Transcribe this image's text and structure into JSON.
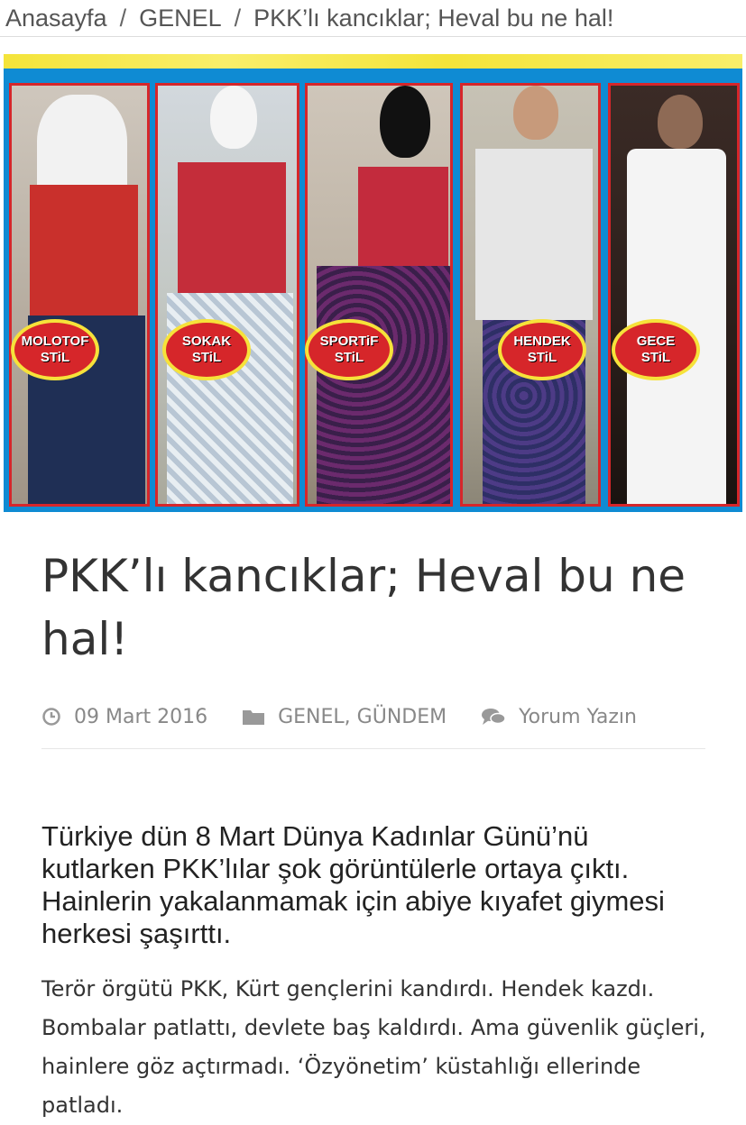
{
  "breadcrumb": {
    "items": [
      "Anasayfa",
      "GENEL",
      "PKK’lı kancıklar; Heval bu ne hal!"
    ],
    "separator": "/"
  },
  "hero": {
    "badges": [
      {
        "line1": "MOLOTOF",
        "line2": "STiL"
      },
      {
        "line1": "SOKAK",
        "line2": "STiL"
      },
      {
        "line1": "SPORTiF",
        "line2": "STiL"
      },
      {
        "line1": "HENDEK",
        "line2": "STiL"
      },
      {
        "line1": "GECE",
        "line2": "STiL"
      }
    ],
    "colors": {
      "background": "#0f8bd3",
      "frame": "#d6262a",
      "badge_ring": "#f6e23a"
    }
  },
  "article": {
    "title": "PKK’lı kancıklar; Heval bu ne hal!",
    "date": "09 Mart 2016",
    "categories": [
      "GENEL",
      "GÜNDEM"
    ],
    "category_separator": ", ",
    "comment_label": "Yorum Yazın",
    "icons": [
      "clock-icon",
      "folder-icon",
      "comments-icon"
    ],
    "lead": "Türkiye dün 8 Mart Dünya Kadınlar Günü’nü kutlarken PKK’lılar şok görüntülerle ortaya çıktı. Hainlerin yakalanmamak için abiye kıyafet giymesi herkesi şaşırttı.",
    "body": "Terör örgütü PKK, Kürt gençlerini kandırdı. Hendek kazdı. Bombalar patlattı, devlete baş kaldırdı. Ama güvenlik güçleri, hainlere göz açtırmadı. ‘Özyönetim’ küstahlığı ellerinde patladı."
  }
}
